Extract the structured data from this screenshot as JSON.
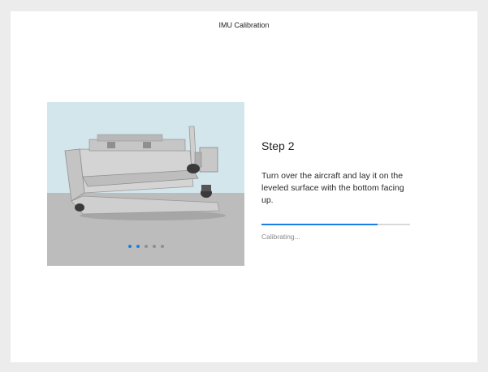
{
  "dialog": {
    "title": "IMU Calibration"
  },
  "illustration": {
    "icon": "folded-drone-upside-down",
    "slide_count": 5,
    "active_slides": [
      0,
      1
    ]
  },
  "step": {
    "title": "Step 2",
    "instruction": "Turn over the aircraft and lay it on the leveled surface with the bottom facing up."
  },
  "progress": {
    "fraction": 0.78,
    "status": "Calibrating..."
  },
  "colors": {
    "accent": "#1a7fe2",
    "sky": "#d3e6ec",
    "surface": "#bcbcbc"
  }
}
